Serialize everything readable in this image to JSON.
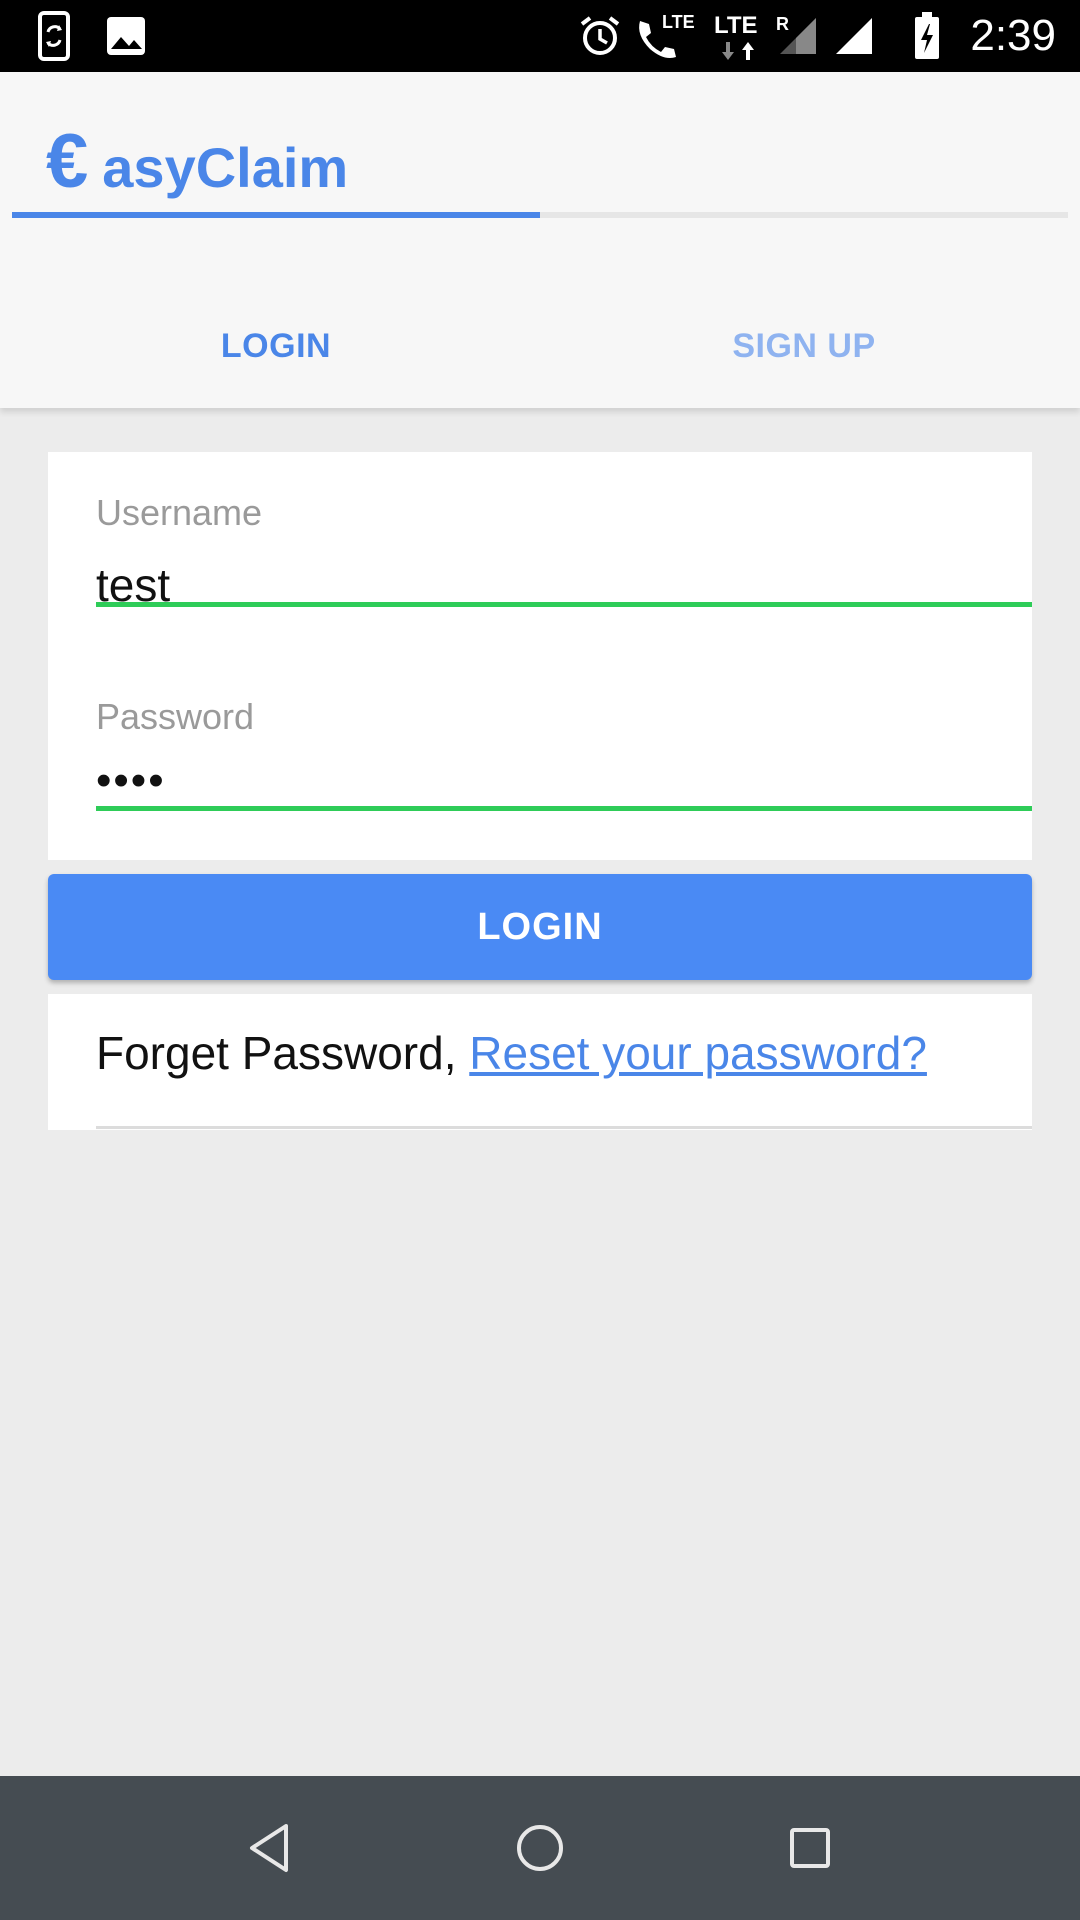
{
  "status_bar": {
    "time": "2:39",
    "icons": [
      "screen-rotate-icon",
      "image-icon",
      "alarm-icon",
      "lte-call-icon",
      "lte-roaming-data-icon",
      "signal-icon",
      "signal-full-icon",
      "battery-charging-icon"
    ],
    "lte_call_label": "LTE",
    "lte_data_label": "LTE",
    "roaming_label": "R"
  },
  "header": {
    "brand_mark": "€",
    "brand_name": "asyClaim",
    "tabs": [
      {
        "label": "LOGIN",
        "active": true
      },
      {
        "label": "SIGN UP",
        "active": false
      }
    ]
  },
  "form": {
    "username": {
      "label": "Username",
      "value": "test"
    },
    "password": {
      "label": "Password",
      "value": "••••"
    },
    "submit_label": "LOGIN"
  },
  "forgot": {
    "text": "Forget Password, ",
    "link_text": "Reset your password?"
  },
  "nav_bar": {
    "icons": [
      "back-icon",
      "home-icon",
      "recents-icon"
    ]
  },
  "colors": {
    "accent": "#4a86e8",
    "button": "#4a8af4",
    "field_underline": "#2ecc58",
    "nav_bar": "#454c52",
    "background": "#ececec"
  }
}
